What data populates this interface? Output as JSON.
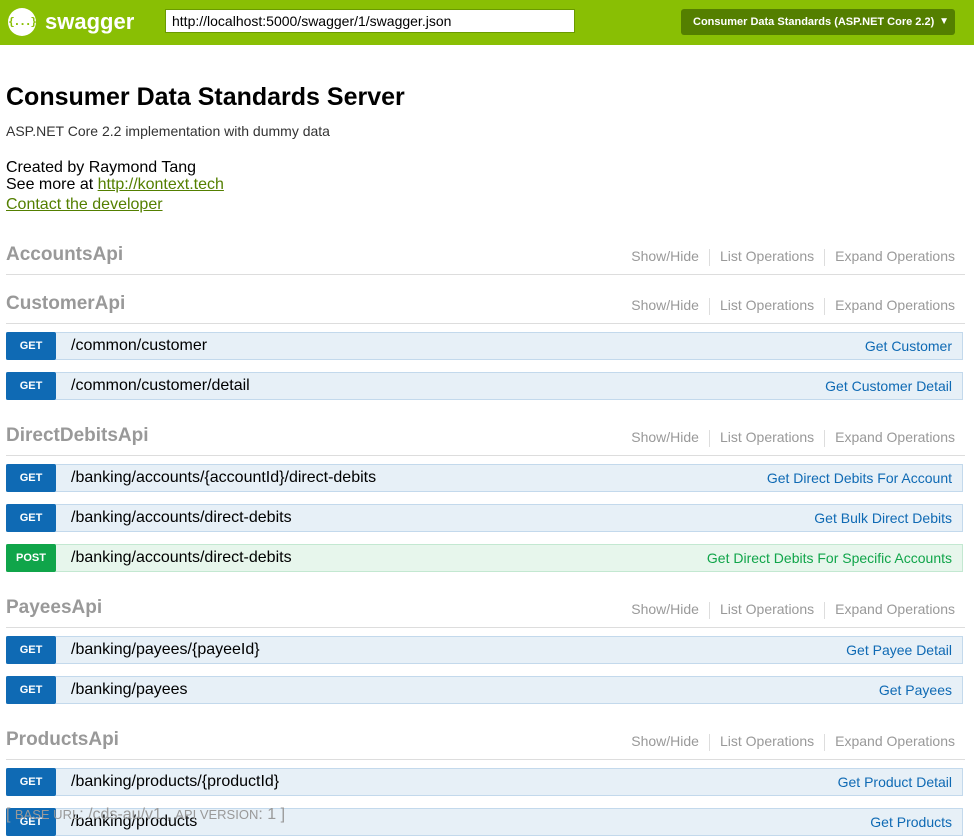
{
  "header": {
    "brand": "swagger",
    "logo_glyph": "{...}",
    "url_value": "http://localhost:5000/swagger/1/swagger.json",
    "spec_selected": "Consumer Data Standards (ASP.NET Core 2.2)",
    "colors": {
      "bar": "#89bf04",
      "select": "#547f00"
    }
  },
  "info": {
    "title": "Consumer Data Standards Server",
    "subtitle": "ASP.NET Core 2.2 implementation with dummy data",
    "created_by": "Created by Raymond Tang",
    "see_more_prefix": "See more at ",
    "see_more_link": "http://kontext.tech",
    "contact": "Contact the developer"
  },
  "resource_actions": {
    "show_hide": "Show/Hide",
    "list_ops": "List Operations",
    "expand_ops": "Expand Operations"
  },
  "resources": [
    {
      "name": "AccountsApi",
      "operations": []
    },
    {
      "name": "CustomerApi",
      "operations": [
        {
          "method": "GET",
          "path": "/common/customer",
          "summary": "Get Customer"
        },
        {
          "method": "GET",
          "path": "/common/customer/detail",
          "summary": "Get Customer Detail"
        }
      ]
    },
    {
      "name": "DirectDebitsApi",
      "operations": [
        {
          "method": "GET",
          "path": "/banking/accounts/{accountId}/direct-debits",
          "summary": "Get Direct Debits For Account"
        },
        {
          "method": "GET",
          "path": "/banking/accounts/direct-debits",
          "summary": "Get Bulk Direct Debits"
        },
        {
          "method": "POST",
          "path": "/banking/accounts/direct-debits",
          "summary": "Get Direct Debits For Specific Accounts"
        }
      ]
    },
    {
      "name": "PayeesApi",
      "operations": [
        {
          "method": "GET",
          "path": "/banking/payees/{payeeId}",
          "summary": "Get Payee Detail"
        },
        {
          "method": "GET",
          "path": "/banking/payees",
          "summary": "Get Payees"
        }
      ]
    },
    {
      "name": "ProductsApi",
      "operations": [
        {
          "method": "GET",
          "path": "/banking/products/{productId}",
          "summary": "Get Product Detail"
        },
        {
          "method": "GET",
          "path": "/banking/products",
          "summary": "Get Products"
        }
      ]
    }
  ],
  "footer": {
    "open": "[ ",
    "base_url_label": "Base URL",
    "base_url": ": /cds-au/v1",
    "sep": " , ",
    "api_version_label": "Api Version",
    "api_version": ": 1",
    "close": " ]"
  },
  "method_colors": {
    "GET": "#0f6ab4",
    "POST": "#10a54a"
  }
}
